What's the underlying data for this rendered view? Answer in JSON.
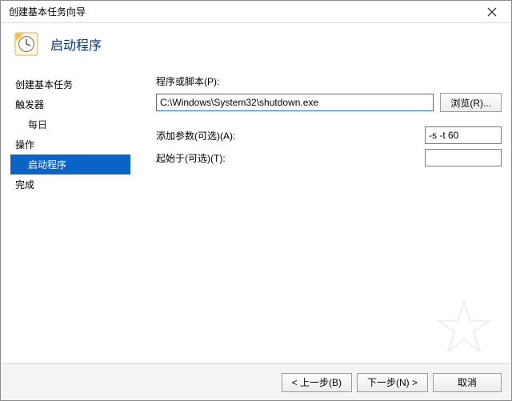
{
  "window": {
    "title": "创建基本任务向导"
  },
  "header": {
    "page_title": "启动程序"
  },
  "sidebar": {
    "items": [
      {
        "label": "创建基本任务"
      },
      {
        "label": "触发器"
      },
      {
        "label": "每日"
      },
      {
        "label": "操作"
      },
      {
        "label": "启动程序"
      },
      {
        "label": "完成"
      }
    ]
  },
  "form": {
    "program_label": "程序或脚本(P):",
    "program_value": "C:\\Windows\\System32\\shutdown.exe",
    "browse_label": "浏览(R)...",
    "args_label": "添加参数(可选)(A):",
    "args_value": "-s -t 60",
    "startin_label": "起始于(可选)(T):",
    "startin_value": ""
  },
  "footer": {
    "back_label": "< 上一步(B)",
    "next_label": "下一步(N) >",
    "cancel_label": "取消"
  }
}
